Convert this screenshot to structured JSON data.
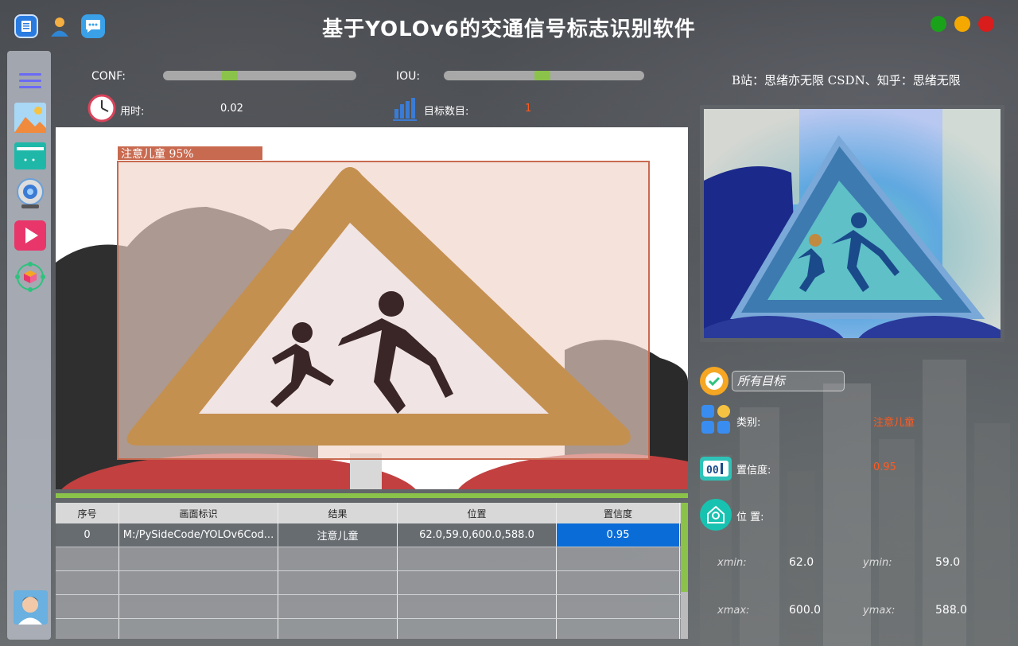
{
  "app": {
    "title": "基于YOLOv6的交通信号标志识别软件",
    "credit": "B站：思绪亦无限  CSDN、知乎：思绪无限"
  },
  "window_buttons": [
    {
      "name": "minimize",
      "color": "#1aa31a"
    },
    {
      "name": "maximize",
      "color": "#f5a800"
    },
    {
      "name": "close",
      "color": "#d91c1c"
    }
  ],
  "controls": {
    "conf_label": "CONF:",
    "conf_value": 0.33,
    "iou_label": "IOU:",
    "iou_value": 0.49,
    "time_label": "用时:",
    "time_value": "0.02",
    "count_label": "目标数目:",
    "count_value": "1"
  },
  "detection": {
    "label": "注意儿童  95%"
  },
  "table": {
    "headers": [
      "序号",
      "画面标识",
      "结果",
      "位置",
      "置信度"
    ],
    "rows": [
      [
        "0",
        "M:/PySideCode/YOLOv6Cod...",
        "注意儿童",
        "62.0,59.0,600.0,588.0",
        "0.95"
      ],
      [
        "",
        "",
        "",
        "",
        ""
      ],
      [
        "",
        "",
        "",
        "",
        ""
      ],
      [
        "",
        "",
        "",
        "",
        ""
      ],
      [
        "",
        "",
        "",
        "",
        ""
      ]
    ]
  },
  "result_panel": {
    "target_select": "所有目标",
    "class_label": "类别:",
    "class_value": "注意儿童",
    "conf_label": "置信度:",
    "conf_value": "0.95",
    "pos_label": "位 置:",
    "xmin_label": "xmin:",
    "xmin_value": "62.0",
    "ymin_label": "ymin:",
    "ymin_value": "59.0",
    "xmax_label": "xmax:",
    "xmax_value": "600.0",
    "ymax_label": "ymax:",
    "ymax_value": "588.0"
  },
  "colors": {
    "accent_green": "#8bc34a",
    "value_orange": "#ff5a1f",
    "selected_blue": "#0a6cd6"
  }
}
